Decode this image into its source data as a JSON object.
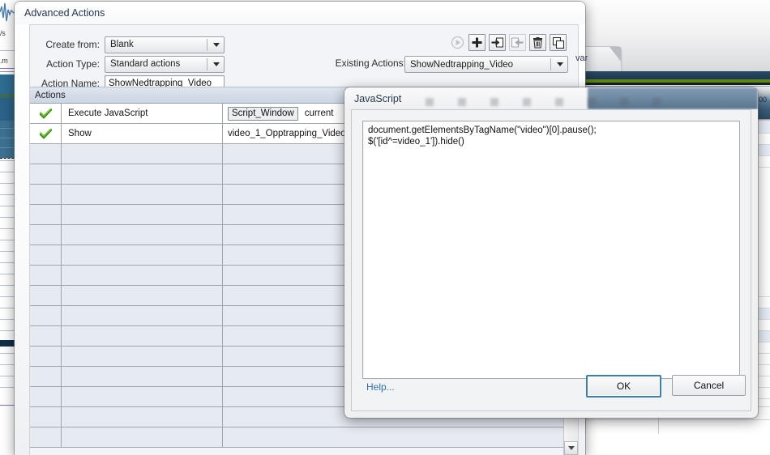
{
  "background": {
    "tab_label": "var",
    "strip_labels": [
      "/s",
      ".m"
    ],
    "ruler_label": "00"
  },
  "advanced_actions": {
    "title": "Advanced Actions",
    "fields": {
      "create_from": {
        "label": "Create from:",
        "value": "Blank"
      },
      "action_type": {
        "label": "Action Type:",
        "value": "Standard actions"
      },
      "action_name": {
        "label": "Action Name:",
        "value": "ShowNedtrapping_Video"
      }
    },
    "existing_actions": {
      "label": "Existing Actions:",
      "value": "ShowNedtrapping_Video"
    },
    "toolbar": [
      {
        "name": "preview-icon",
        "title": "Preview",
        "disabled": true
      },
      {
        "name": "add-icon",
        "title": "Add",
        "disabled": false
      },
      {
        "name": "save-as-icon",
        "title": "Save As",
        "disabled": false
      },
      {
        "name": "restore-icon",
        "title": "Restore",
        "disabled": true
      },
      {
        "name": "delete-icon",
        "title": "Delete",
        "disabled": false
      },
      {
        "name": "duplicate-icon",
        "title": "Duplicate",
        "disabled": false
      }
    ],
    "table": {
      "header": "Actions",
      "rows": [
        {
          "checked": true,
          "action": "Execute JavaScript",
          "chip": "Script_Window",
          "value": "current"
        },
        {
          "checked": true,
          "action": "Show",
          "chip": "",
          "value": "video_1_Opptrapping_Video"
        }
      ],
      "empty_row_count": 15
    }
  },
  "javascript_dialog": {
    "title": "JavaScript",
    "code": "document.getElementsByTagName(\"video\")[0].pause();\n$('[id^=video_1']).hide()",
    "help_label": "Help...",
    "ok_label": "OK",
    "cancel_label": "Cancel"
  },
  "colors": {
    "accent_blue": "#3c7fb1",
    "link_blue": "#2f6fb5",
    "check_green": "#4aa317",
    "row_fill": "#e6eaf1",
    "header_fill": "#ccd5e2"
  }
}
